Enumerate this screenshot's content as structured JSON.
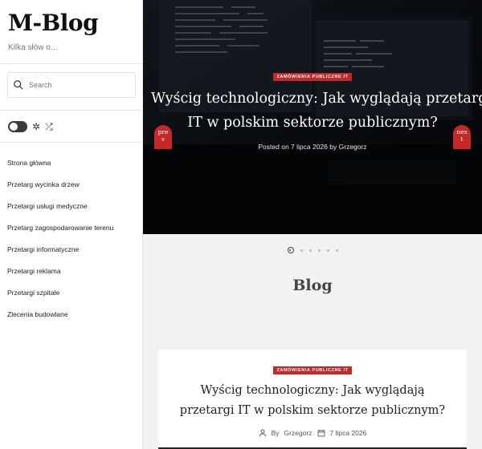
{
  "site": {
    "title": "M-Blog",
    "tagline": "Kilka słów o..."
  },
  "search": {
    "placeholder": "Search"
  },
  "controls": {
    "toggle_icon": "toggle-icon",
    "settings_icon": "gear-icon",
    "shuffle_icon": "shuffle-icon"
  },
  "nav": {
    "items": [
      {
        "label": "Strona główna"
      },
      {
        "label": "Przetarg wycinka drzew"
      },
      {
        "label": "Przetargi usługi medyczne"
      },
      {
        "label": "Przetarg zagospodarowanie terenu"
      },
      {
        "label": "Przetargi informatyczne"
      },
      {
        "label": "Przetargi reklama"
      },
      {
        "label": "Przetargi szpitale"
      },
      {
        "label": "Zlecenia budowlane"
      }
    ]
  },
  "hero": {
    "category": "ZAMÓWIENIA PUBLICZNE IT",
    "title_line1": "Wyścig technologiczny: Jak wyglądają przetargi",
    "title_line2": "IT w polskim sektorze publicznym?",
    "posted_prefix": "Posted on",
    "date": "7 lipca 2026",
    "by_prefix": "by",
    "author": "Grzegorz",
    "prev_label_1": "pre",
    "prev_label_2": "v",
    "next_label_1": "nex",
    "next_label_2": "t",
    "slides_total": 6,
    "slide_active": 1
  },
  "blog": {
    "heading": "Blog"
  },
  "card": {
    "category": "ZAMÓWIENIA PUBLICZNE IT",
    "title": "Wyścig technologiczny: Jak wyglądają przetargi IT w polskim sektorze publicznym?",
    "by_prefix": "By",
    "author": "Grzegorz",
    "date": "7 lipca 2026"
  },
  "colors": {
    "accent": "#c62828",
    "sidebar_bg": "#ffffff",
    "page_bg": "#f2f2f2"
  }
}
